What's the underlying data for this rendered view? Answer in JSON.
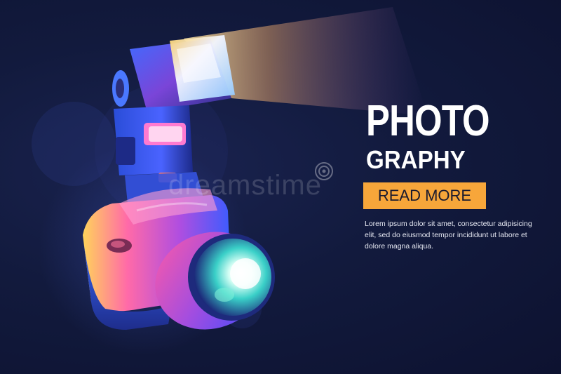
{
  "banner": {
    "title_line1": "PHOTO",
    "title_line2": "GRAPHY",
    "cta_label": "READ MORE",
    "body_text": "Lorem ipsum dolor sit amet, consectetur adipisicing elit, sed do eiusmod tempor incididunt ut labore et dolore magna aliqua.",
    "watermark": "dreamstime",
    "colors": {
      "background": "#0f1533",
      "cta": "#f7a63a",
      "text": "#ffffff"
    }
  },
  "illustration": {
    "icons": [
      "camera-flash-icon",
      "dslr-camera-icon",
      "camera-lens-icon",
      "light-beam-icon"
    ]
  }
}
